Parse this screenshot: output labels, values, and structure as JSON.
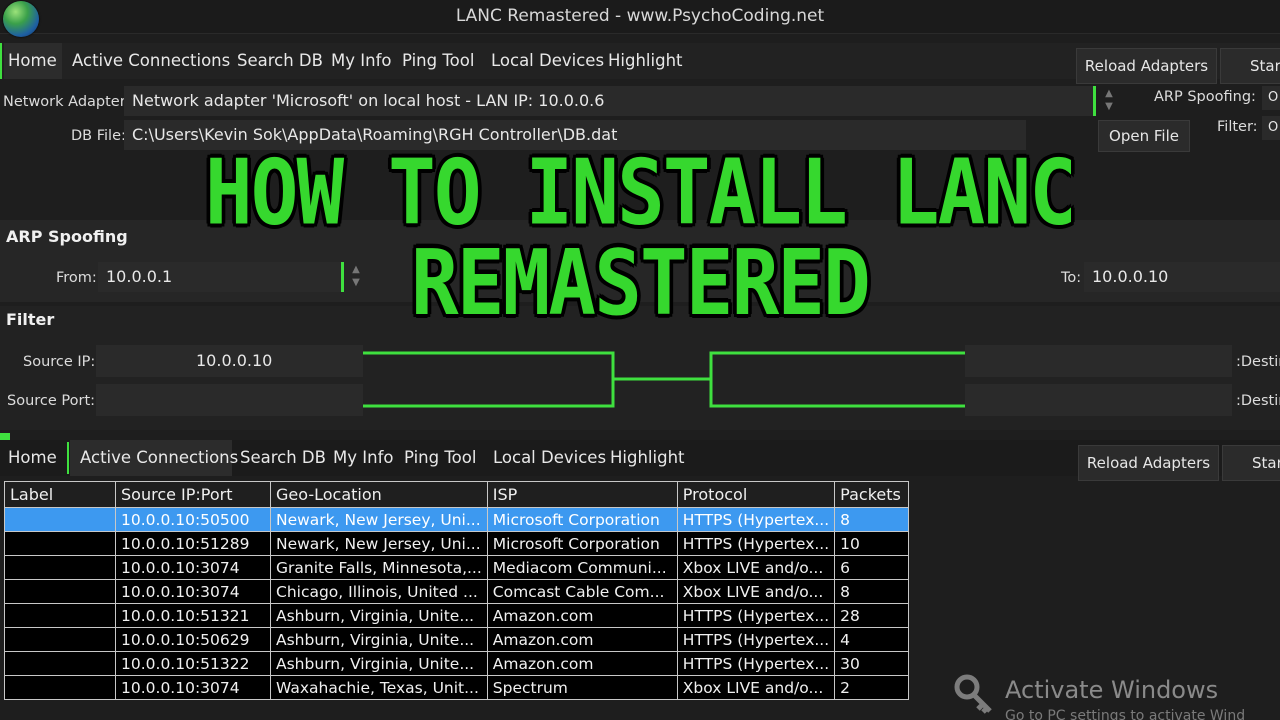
{
  "window": {
    "title": "LANC Remastered - www.PsychoCoding.net",
    "minimize": "—",
    "maximize": "☐",
    "close": "✕"
  },
  "top_tabs": [
    "Home",
    "Active Connections",
    "Search DB",
    "My Info",
    "Ping Tool",
    "Local Devices",
    "Highlight"
  ],
  "top_buttons": {
    "reload": "Reload Adapters",
    "start": "Start"
  },
  "settings": {
    "network_adapter_label": "Network Adapter:",
    "network_adapter_value": "Network adapter 'Microsoft' on local host - LAN IP: 10.0.0.6",
    "arp_spoofing_label": "ARP Spoofing:",
    "arp_spoofing_value": "O",
    "db_file_label": "DB File:",
    "db_file_value": "C:\\Users\\Kevin Sok\\AppData\\Roaming\\RGH Controller\\DB.dat",
    "open_file": "Open File",
    "filter_label": "Filter:",
    "filter_value": "O"
  },
  "banner": "HOW TO INSTALL LANC REMASTERED",
  "arp": {
    "section_title": "ARP Spoofing",
    "from_label": "From:",
    "from_value": "10.0.0.1",
    "to_label": "To:",
    "to_value": "10.0.0.10"
  },
  "filter": {
    "section_title": "Filter",
    "source_ip_label": "Source IP:",
    "source_ip_value": "10.0.0.10",
    "source_port_label": "Source Port:",
    "source_port_value": "",
    "dest_label_1": ":Destin",
    "dest_label_2": ":Destin"
  },
  "bottom_tabs": [
    "Home",
    "Active Connections",
    "Search DB",
    "My Info",
    "Ping Tool",
    "Local Devices",
    "Highlight"
  ],
  "bottom_buttons": {
    "reload": "Reload Adapters",
    "start": "Start"
  },
  "table": {
    "columns": [
      "Label",
      "Source IP:Port",
      "Geo-Location",
      "ISP",
      "Protocol",
      "Packets"
    ],
    "rows": [
      [
        "",
        "10.0.0.10:50500",
        "Newark, New Jersey, Uni...",
        "Microsoft Corporation",
        "HTTPS (Hypertex...",
        "8"
      ],
      [
        "",
        "10.0.0.10:51289",
        "Newark, New Jersey, Uni...",
        "Microsoft Corporation",
        "HTTPS (Hypertex...",
        "10"
      ],
      [
        "",
        "10.0.0.10:3074",
        "Granite Falls, Minnesota,...",
        "Mediacom Communi...",
        "Xbox LIVE and/o...",
        "6"
      ],
      [
        "",
        "10.0.0.10:3074",
        "Chicago, Illinois, United ...",
        "Comcast Cable Com...",
        "Xbox LIVE and/o...",
        "8"
      ],
      [
        "",
        "10.0.0.10:51321",
        "Ashburn, Virginia, Unite...",
        "Amazon.com",
        "HTTPS (Hypertex...",
        "28"
      ],
      [
        "",
        "10.0.0.10:50629",
        "Ashburn, Virginia, Unite...",
        "Amazon.com",
        "HTTPS (Hypertex...",
        "4"
      ],
      [
        "",
        "10.0.0.10:51322",
        "Ashburn, Virginia, Unite...",
        "Amazon.com",
        "HTTPS (Hypertex...",
        "30"
      ],
      [
        "",
        "10.0.0.10:3074",
        "Waxahachie, Texas, Unit...",
        "Spectrum",
        "Xbox LIVE and/o...",
        "2"
      ]
    ]
  },
  "watermark": {
    "title": "Activate Windows",
    "subtitle": "Go to PC settings to activate Wind"
  },
  "colors": {
    "accent_green": "#36d82e",
    "selection_blue": "#3d99f0",
    "background": "#1e1e1e"
  }
}
